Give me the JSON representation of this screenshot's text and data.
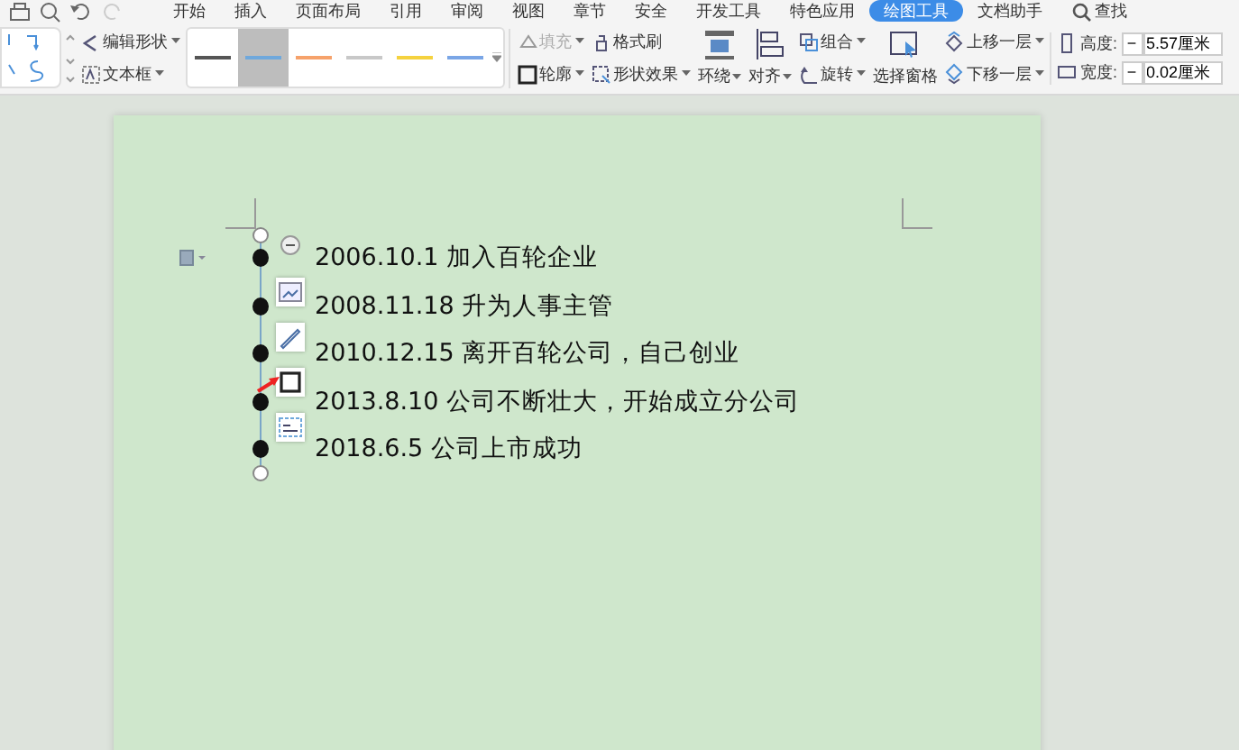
{
  "tabs": [
    {
      "label": "开始",
      "selected": false
    },
    {
      "label": "插入",
      "selected": false
    },
    {
      "label": "页面布局",
      "selected": false
    },
    {
      "label": "引用",
      "selected": false
    },
    {
      "label": "审阅",
      "selected": false
    },
    {
      "label": "视图",
      "selected": false
    },
    {
      "label": "章节",
      "selected": false
    },
    {
      "label": "安全",
      "selected": false
    },
    {
      "label": "开发工具",
      "selected": false
    },
    {
      "label": "特色应用",
      "selected": false
    },
    {
      "label": "绘图工具",
      "selected": true
    },
    {
      "label": "文档助手",
      "selected": false
    }
  ],
  "search": {
    "label": "查找"
  },
  "edit_buttons": [
    {
      "label": "编辑形状",
      "dropdown": true,
      "disabled": false
    },
    {
      "label": "文本框",
      "dropdown": true,
      "disabled": false
    }
  ],
  "line_styles": [
    {
      "color": "#555555",
      "selected": false
    },
    {
      "color": "#6fa8dc",
      "selected": true
    },
    {
      "color": "#f6a26b",
      "selected": false
    },
    {
      "color": "#c8c8c8",
      "selected": false
    },
    {
      "color": "#f5d23f",
      "selected": false
    },
    {
      "color": "#7aa6e6",
      "selected": false
    }
  ],
  "style_buttons": [
    {
      "label": "填充",
      "dropdown": true,
      "disabled": true
    },
    {
      "label": "格式刷",
      "dropdown": false,
      "disabled": false
    },
    {
      "label": "轮廓",
      "dropdown": true,
      "disabled": false
    },
    {
      "label": "形状效果",
      "dropdown": true,
      "disabled": false
    }
  ],
  "arrange_big": [
    {
      "label": "环绕",
      "dropdown": true
    },
    {
      "label": "对齐",
      "dropdown": true
    }
  ],
  "arrange_small": [
    {
      "label": "组合",
      "dropdown": true
    },
    {
      "label": "旋转",
      "dropdown": true
    }
  ],
  "pane_button": {
    "label": "选择窗格"
  },
  "layer_buttons": [
    {
      "label": "上移一层",
      "dropdown": true
    },
    {
      "label": "下移一层",
      "dropdown": true
    }
  ],
  "size_fields": [
    {
      "label": "高度:",
      "minus": "−",
      "value": "5.57厘米"
    },
    {
      "label": "宽度:",
      "minus": "−",
      "value": "0.02厘米"
    }
  ],
  "timeline": [
    {
      "text": "2006.10.1 加入百轮企业"
    },
    {
      "text": "2008.11.18 升为人事主管"
    },
    {
      "text": "2010.12.15 离开百轮公司，自己创业"
    },
    {
      "text": "2013.8.10 公司不断壮大，开始成立分公司"
    },
    {
      "text": "2018.6.5 公司上市成功"
    }
  ]
}
